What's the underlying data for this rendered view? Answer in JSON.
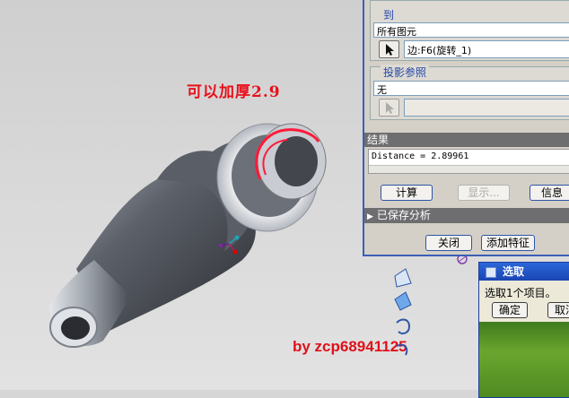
{
  "annotations": {
    "thickness_note": "可以加厚2.9",
    "watermark": "by zcp68941125"
  },
  "measure_dialog": {
    "to_group": {
      "legend": "到",
      "dropdown_value": "所有图元",
      "selection_value": "边:F6(旋转_1)",
      "select_button_icon": "arrow-cursor-icon"
    },
    "projection_group": {
      "legend": "投影参照",
      "dropdown_value": "无",
      "selection_value": "",
      "select_button_icon": "arrow-cursor-icon"
    },
    "result": {
      "header": "结果",
      "text": "Distance = 2.89961"
    },
    "buttons": {
      "compute": "计算",
      "show": "显示...",
      "info": "信息"
    },
    "saved_analysis": "已保存分析",
    "close": "关闭",
    "add_feature": "添加特征"
  },
  "select_dialog": {
    "title": "选取",
    "message": "选取1个项目。",
    "ok": "确定",
    "cancel": "取消"
  },
  "colors": {
    "annotation_red": "#e8101a",
    "dialog_border": "#3b5fb5",
    "legend_blue": "#2446a8",
    "title_bar_blue": "#1b45b3"
  }
}
